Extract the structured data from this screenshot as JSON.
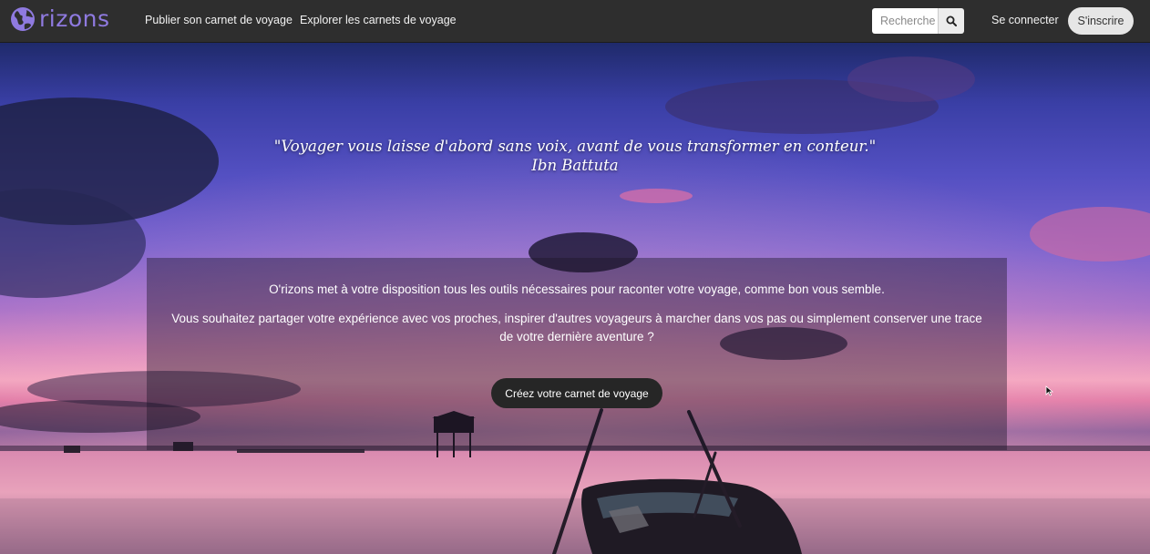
{
  "brand": {
    "name": "rizons",
    "accent": "#8f7ae0"
  },
  "nav": {
    "links": [
      {
        "label": "Publier son carnet de voyage"
      },
      {
        "label": "Explorer les carnets de voyage"
      }
    ],
    "search": {
      "placeholder": "Recherche",
      "icon": "search-icon"
    },
    "login_label": "Se connecter",
    "signup_label": "S'inscrire"
  },
  "hero": {
    "quote": "\"Voyager vous laisse d'abord sans voix, avant de vous transformer en conteur.\"",
    "author": "Ibn Battuta",
    "intro": {
      "paragraph1": "O'rizons met à votre disposition tous les outils nécessaires pour raconter votre voyage, comme bon vous semble.",
      "paragraph2": "Vous souhaitez partager votre expérience avec vos proches, inspirer d'autres voyageurs à marcher dans vos pas ou simplement conserver une trace de votre dernière aventure ?",
      "cta_label": "Créez votre carnet de voyage"
    }
  }
}
